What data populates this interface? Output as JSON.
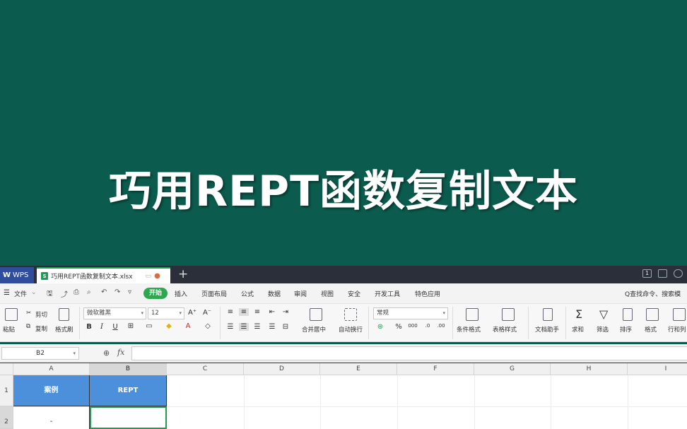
{
  "banner": {
    "title": "巧用REPT函数复制文本"
  },
  "titlebar": {
    "app_label": "WPS",
    "doc_tab_label": "巧用REPT函数复制文本.xlsx",
    "new_tab_glyph": "+",
    "page_indicator": "1"
  },
  "menubar": {
    "file_label": "文件",
    "tabs": [
      "开始",
      "插入",
      "页面布局",
      "公式",
      "数据",
      "审阅",
      "视图",
      "安全",
      "开发工具",
      "特色应用"
    ],
    "search_label": "Q查找命令、搜索模"
  },
  "ribbon": {
    "paste_label": "粘贴",
    "cut_label": "剪切",
    "copy_label": "复制",
    "format_painter_label": "格式刷",
    "font_name": "微软雅黑",
    "font_size": "12",
    "merge_label": "合并居中",
    "wrap_label": "自动换行",
    "number_format": "常规",
    "cond_format_label": "条件格式",
    "table_style_label": "表格样式",
    "doc_helper_label": "文档助手",
    "sum_label": "求和",
    "filter_label": "筛选",
    "sort_label": "排序",
    "format_label": "格式",
    "rowcol_label": "行和列"
  },
  "formula_bar": {
    "name_box": "B2",
    "fx_label": "fx",
    "value": ""
  },
  "sheet": {
    "columns": [
      "A",
      "B",
      "C",
      "D",
      "E",
      "F",
      "G",
      "H",
      "I"
    ],
    "rows": [
      "1",
      "2"
    ],
    "cells": {
      "A1": "案例",
      "B1": "REPT",
      "A2": "-",
      "B2": ""
    }
  },
  "colors": {
    "banner_bg": "#0b5c4e",
    "header_fill": "#4c8fdb",
    "accent_green": "#2da84f"
  }
}
